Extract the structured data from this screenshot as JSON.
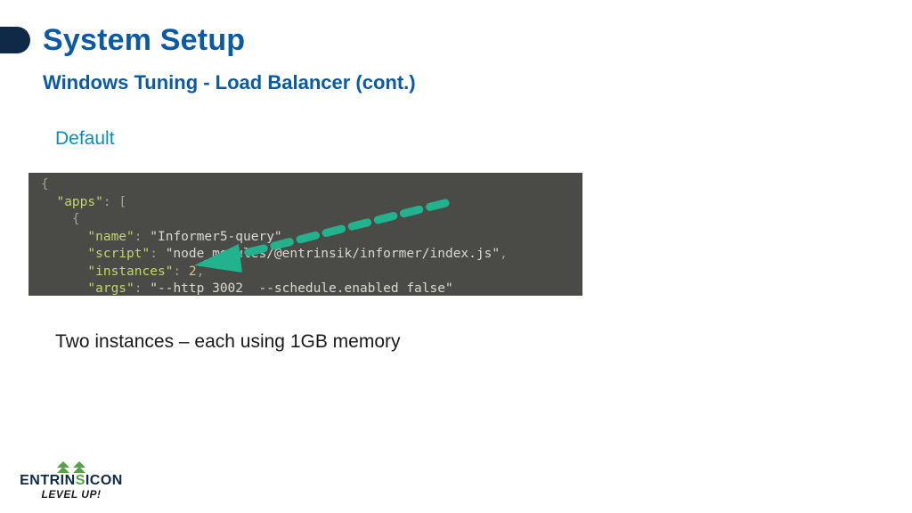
{
  "title": "System Setup",
  "subtitle": "Windows Tuning  -  Load Balancer (cont.)",
  "section_label": "Default",
  "caption": "Two instances – each using 1GB memory",
  "code": {
    "line0_brace": "{",
    "apps_key": "\"apps\"",
    "apps_after": ": [",
    "obj_open": "    {",
    "name_key": "\"name\"",
    "name_val": "\"Informer5-query\"",
    "script_key": "\"script\"",
    "script_val": "\"node_modules/@entrinsik/informer/index.js\"",
    "instances_key": "\"instances\"",
    "instances_val": "2",
    "args_key": "\"args\"",
    "args_val": "\"--http 3002  --schedule.enabled false\"",
    "obj_close": "    },"
  },
  "logo": {
    "part1": "ENTRIN",
    "part2": "S",
    "part3": "ICON",
    "sub": "LEVEL UP!"
  }
}
